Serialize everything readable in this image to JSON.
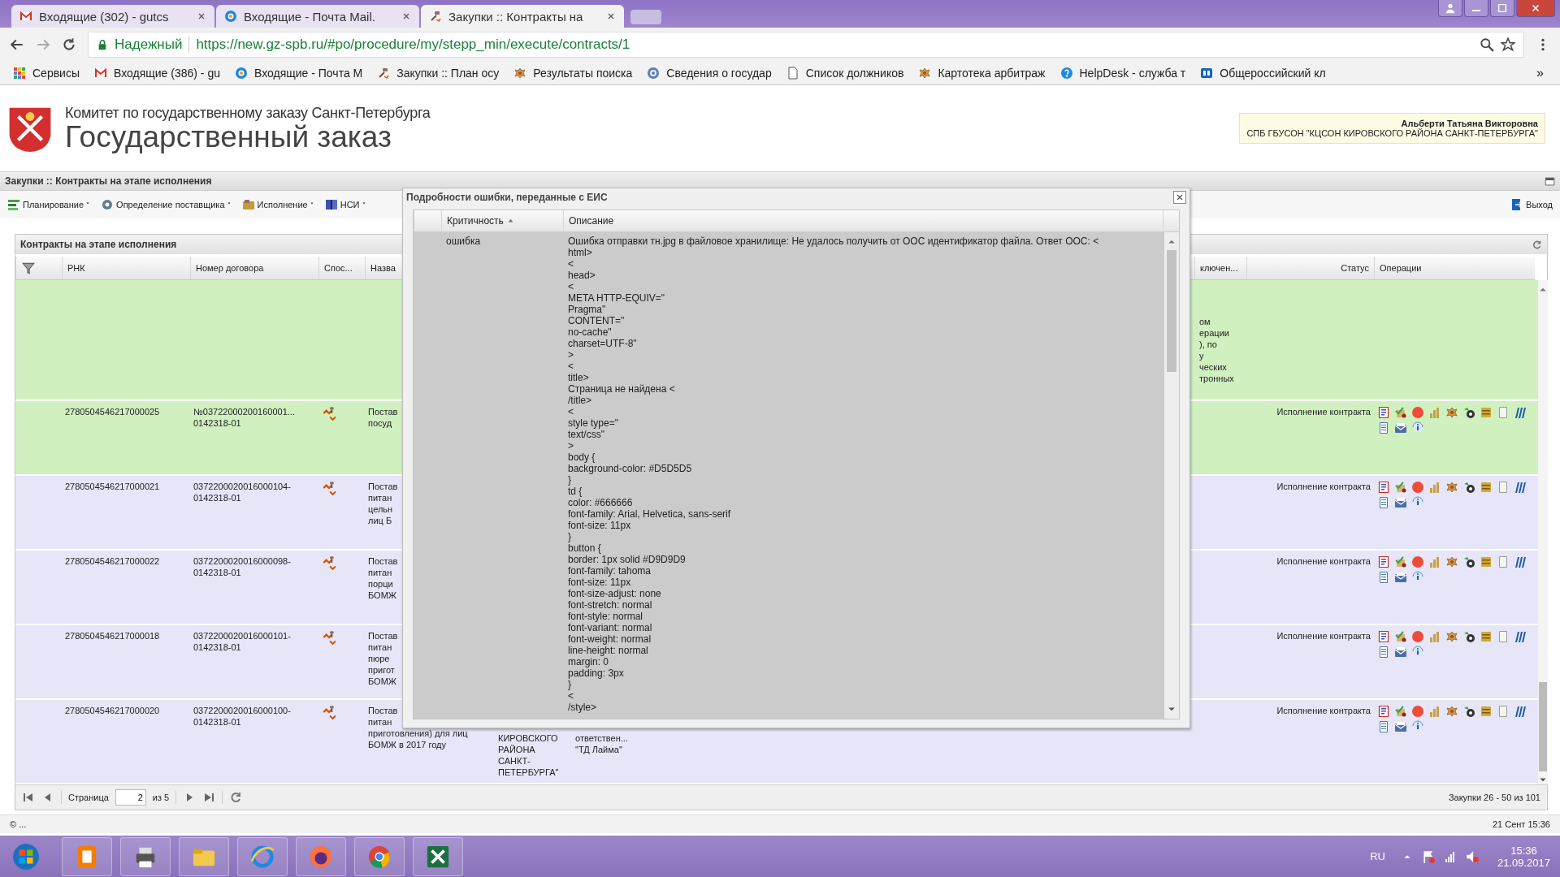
{
  "browser": {
    "tabs": [
      {
        "title": "Входящие (302) - gutcs",
        "selected": false,
        "kind": "gmail"
      },
      {
        "title": "Входящие - Почта Mail.",
        "selected": false,
        "kind": "mail"
      },
      {
        "title": "Закупки :: Контракты на",
        "selected": true,
        "kind": "gavel"
      }
    ],
    "security_label": "Надежный",
    "url": "https://new.gz-spb.ru/#po/procedure/my/stepp_min/execute/contracts/1",
    "bookmarks": [
      {
        "label": "Сервисы",
        "kind": "apps"
      },
      {
        "label": "Входящие (386) - gu",
        "kind": "gmail"
      },
      {
        "label": "Входящие - Почта М",
        "kind": "mail"
      },
      {
        "label": "Закупки :: План осу",
        "kind": "gavel"
      },
      {
        "label": "Результаты поиска",
        "kind": "emblem"
      },
      {
        "label": "Сведения о государ",
        "kind": "globe"
      },
      {
        "label": "Список должников",
        "kind": "page"
      },
      {
        "label": "Картотека арбитраж",
        "kind": "emblem"
      },
      {
        "label": "HelpDesk - служба т",
        "kind": "help"
      },
      {
        "label": "Общероссийский кл",
        "kind": "brand"
      }
    ],
    "bookmarks_more": "»"
  },
  "header": {
    "org": "Комитет по государственному заказу Санкт-Петербурга",
    "title": "Государственный заказ",
    "user_name": "Альберти Татьяна Викторовна",
    "user_org": "СПБ ГБУСОН \"КЦСОН КИРОВСКОГО РАЙОНА САНКТ-ПЕТЕРБУРГА\""
  },
  "page_title": "Закупки :: Контракты на этапе исполнения",
  "menu": [
    {
      "label": "Планирование",
      "kind": "plan"
    },
    {
      "label": "Определение поставщика",
      "kind": "gear"
    },
    {
      "label": "Исполнение",
      "kind": "exec"
    },
    {
      "label": "НСИ",
      "kind": "book"
    }
  ],
  "logout": "Выход",
  "panel": {
    "title": "Контракты на этапе исполнения",
    "columns": {
      "rnk": "РНК",
      "contract_number": "Номер договора",
      "method": "Спос...",
      "name": "Назва",
      "column_9": "ключен...",
      "status": "Статус",
      "operations": "Операции"
    },
    "rows": [
      {
        "highlighted": true,
        "column_9": "ом\nерации\n), по\nу\nческих\nтронных"
      },
      {
        "highlighted": true,
        "rnk": "2780504546217000025",
        "contract_number": "№03722000200160001...\n0142318-01",
        "name": "Постав\nпосуд",
        "status": "Исполнение контракта"
      },
      {
        "highlighted": false,
        "rnk": "2780504546217000021",
        "contract_number": "0372200020016000104-\n0142318-01",
        "name": "Постав\nпитан\nцельн\nлиц Б",
        "status": "Исполнение контракта"
      },
      {
        "highlighted": false,
        "rnk": "2780504546217000022",
        "contract_number": "0372200020016000098-\n0142318-01",
        "name": "Постав\nпитан\nпорци\nБОМЖ",
        "status": "Исполнение контракта"
      },
      {
        "highlighted": false,
        "rnk": "2780504546217000018",
        "contract_number": "0372200020016000101-\n0142318-01",
        "name": "Постав\nпитан\nпюре\nпригот\nБОМЖ",
        "status": "Исполнение контракта"
      },
      {
        "highlighted": false,
        "rnk": "2780504546217000020",
        "contract_number": "0372200020016000100-\n0142318-01",
        "name": "Постав\nпитан\nприготовления) для лиц\nБОМЖ в 2017 году",
        "customer": "КИРОВСКОГО\nРАЙОНА\nСАНКТ-\nПЕТЕРБУРГА\"",
        "supplier": "ответствен...\n\"ТД Лайма\"",
        "status": "Исполнение контракта"
      }
    ],
    "pager": {
      "page_label": "Страница",
      "page": "2",
      "of": "из 5",
      "summary": "Закупки 26 - 50 из 101"
    }
  },
  "dialog": {
    "title": "Подробности ошибки, переданные с ЕИС",
    "columns": {
      "severity": "Критичность",
      "description": "Описание"
    },
    "sorted_ascending": true,
    "rows": [
      {
        "severity": "ошибка",
        "description": "Ошибка отправки тн.jpg в файловое хранилище: Не удалось получить от ООС идентификатор файла. Ответ ООС: <\nhtml>\n<\nhead>\n<\nMETA HTTP-EQUIV=\"\nPragma\"\nCONTENT=\"\nno-cache\"\ncharset=UTF-8\"\n>\n<\ntitle>\nСтраница не найдена <\n/title>\n<\nstyle type=\"\ntext/css\"\n>\nbody {\nbackground-color: #D5D5D5\n}\ntd {\ncolor: #666666\nfont-family: Arial, Helvetica, sans-serif\nfont-size: 11px\n}\nbutton {\nborder: 1px solid #D9D9D9\nfont-family: tahoma\nfont-size: 11px\nfont-size-adjust: none\nfont-stretch: normal\nfont-style: normal\nfont-variant: normal\nfont-weight: normal\nline-height: normal\nmargin: 0\npadding: 3px\n}\n<\n/style>"
      }
    ]
  },
  "status_bar": {
    "left": "© ...",
    "right": "21 Сент 15:36"
  },
  "taskbar": {
    "language": "RU",
    "time": "15:36",
    "date": "21.09.2017"
  }
}
